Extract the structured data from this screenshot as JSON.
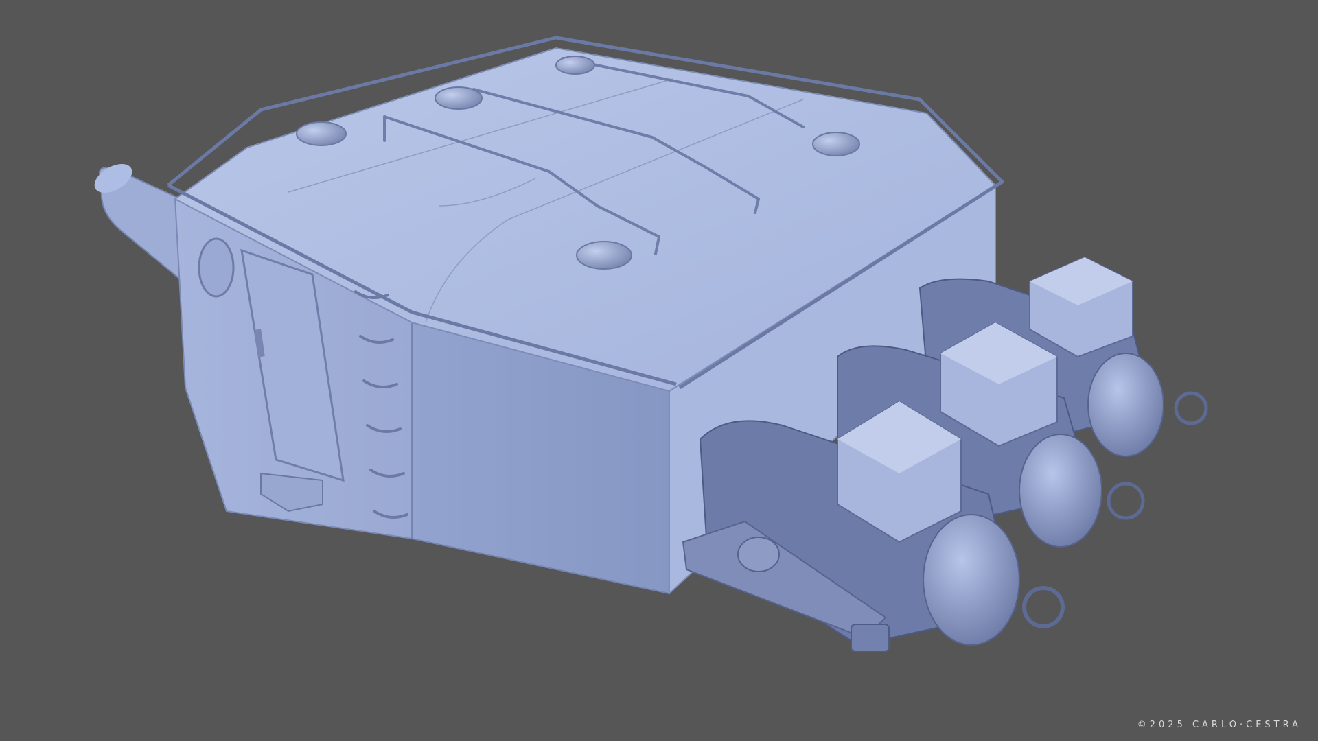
{
  "credit": "©2025 CARLO·CESTRA",
  "colors": {
    "background": "#565656",
    "model_light": "#b3c1e4",
    "model_mid": "#8c9dc9",
    "model_dark": "#5d6b94",
    "edge": "#4a5578"
  }
}
